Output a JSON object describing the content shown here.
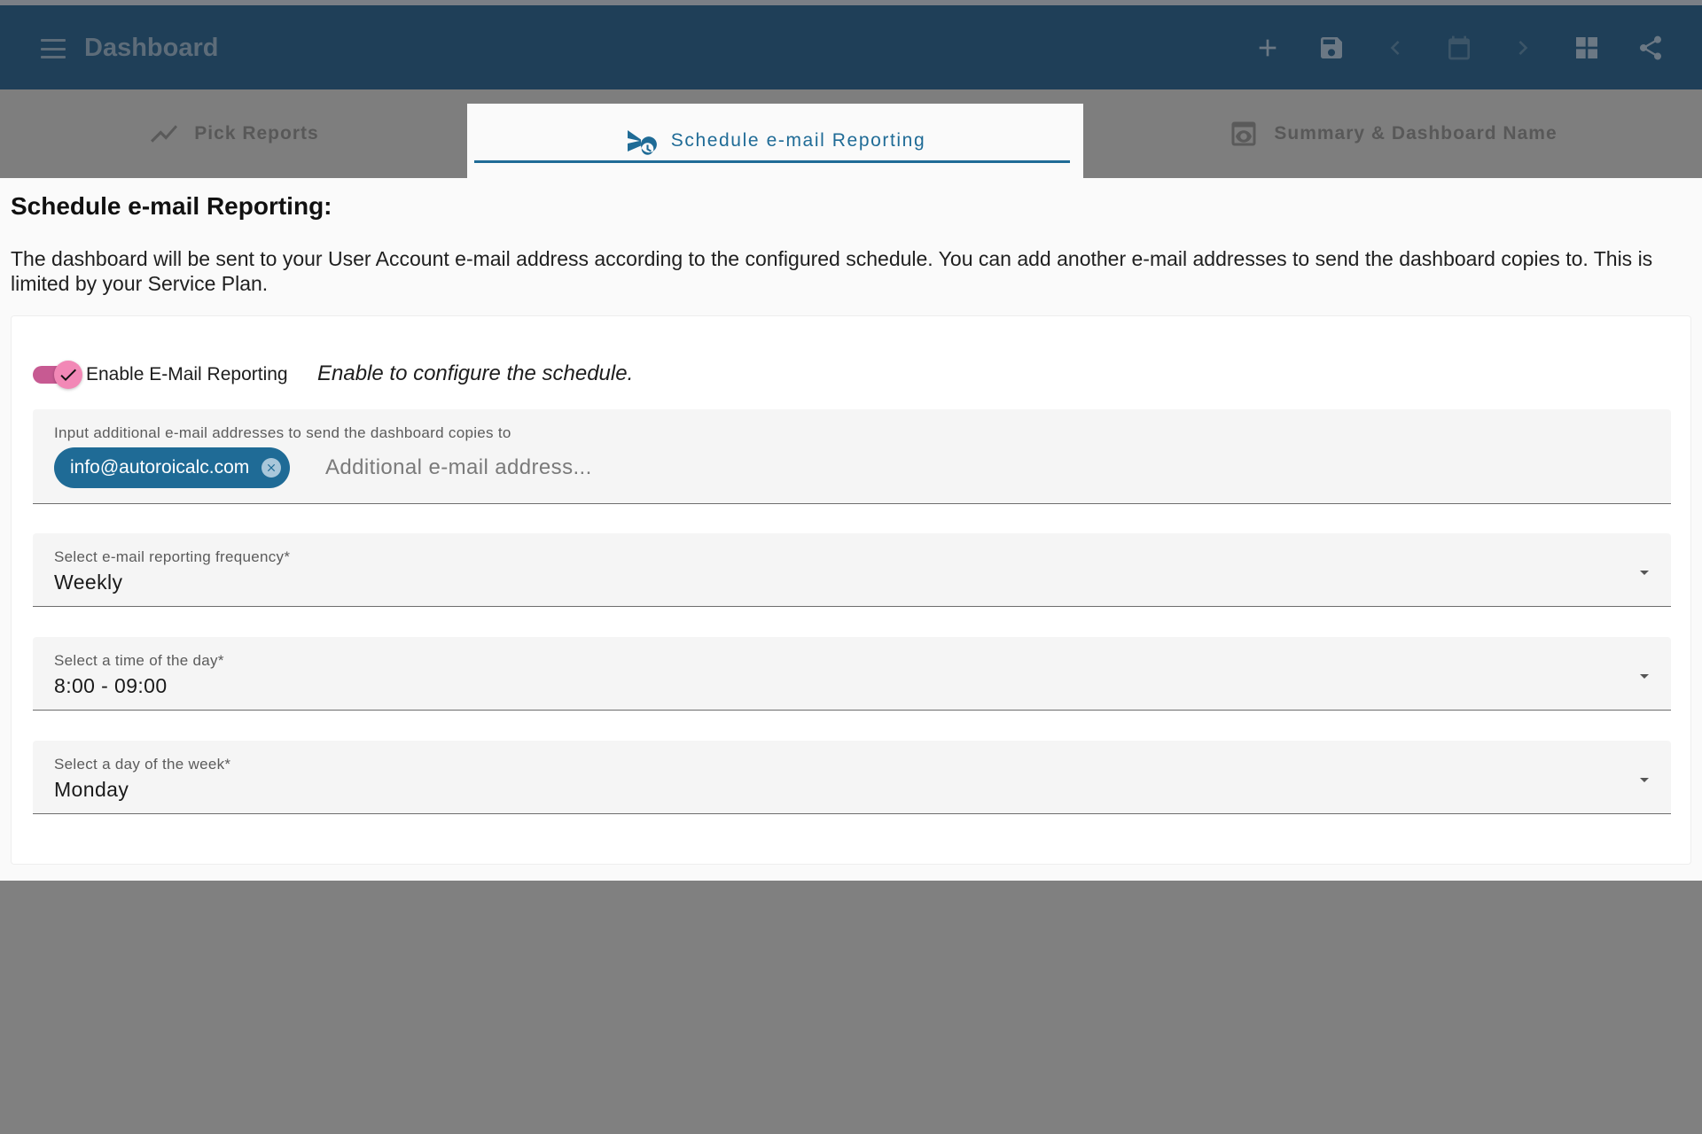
{
  "app_bar": {
    "title": "Dashboard",
    "icons": [
      "menu-icon",
      "add-icon",
      "save-icon",
      "chevron-left-icon",
      "calendar-icon",
      "chevron-right-icon",
      "grid-icon",
      "share-icon"
    ]
  },
  "tabs": [
    {
      "label": "Pick Reports",
      "icon": "chart-line-icon",
      "active": false
    },
    {
      "label": "Schedule e-mail Reporting",
      "icon": "send-clock-icon",
      "active": true
    },
    {
      "label": "Summary & Dashboard Name",
      "icon": "preview-icon",
      "active": false
    }
  ],
  "section": {
    "heading": "Schedule e-mail Reporting:",
    "description": "The dashboard will be sent to your User Account e-mail address according to the configured schedule. You can add another e-mail addresses to send the dashboard copies to. This is limited by your Service Plan."
  },
  "toggle": {
    "label": "Enable E-Mail Reporting",
    "hint": "Enable to configure the schedule.",
    "checked": true
  },
  "emails": {
    "label": "Input additional e-mail addresses to send the dashboard copies to",
    "chips": [
      "info@autoroicalc.com"
    ],
    "placeholder": "Additional e-mail address..."
  },
  "frequency": {
    "label": "Select e-mail reporting frequency*",
    "value": "Weekly"
  },
  "time": {
    "label": "Select a time of the day*",
    "value": "8:00 - 09:00"
  },
  "day": {
    "label": "Select a day of the week*",
    "value": "Monday"
  },
  "colors": {
    "accent": "#1f6b96",
    "app_bar": "#1f3f58",
    "toggle": "#c75a92",
    "overlay": "#808080"
  }
}
